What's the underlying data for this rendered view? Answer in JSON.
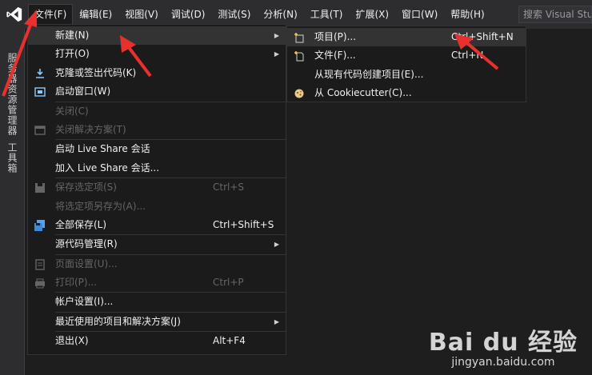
{
  "menubar": {
    "items": [
      "文件(F)",
      "编辑(E)",
      "视图(V)",
      "调试(D)",
      "测试(S)",
      "分析(N)",
      "工具(T)",
      "扩展(X)",
      "窗口(W)",
      "帮助(H)"
    ],
    "search_placeholder": "搜索 Visual Studio"
  },
  "sidebar": {
    "tabs": [
      "服务器资源管理器",
      "工具箱"
    ]
  },
  "file_menu": {
    "items": [
      {
        "label": "新建(N)",
        "has_submenu": true,
        "icon": ""
      },
      {
        "label": "打开(O)",
        "has_submenu": true,
        "icon": ""
      },
      {
        "label": "克隆或签出代码(K)",
        "icon": "download-icon"
      },
      {
        "label": "启动窗口(W)",
        "icon": "start-window-icon"
      },
      {
        "label": "关闭(C)",
        "disabled": true
      },
      {
        "label": "关闭解决方案(T)",
        "disabled": true,
        "icon": "close-solution-icon"
      },
      {
        "label": "启动 Live Share 会话"
      },
      {
        "label": "加入 Live Share 会话..."
      },
      {
        "label": "保存选定项(S)",
        "shortcut": "Ctrl+S",
        "disabled": true,
        "icon": "save-icon"
      },
      {
        "label": "将选定项另存为(A)...",
        "disabled": true
      },
      {
        "label": "全部保存(L)",
        "shortcut": "Ctrl+Shift+S",
        "icon": "save-all-icon"
      },
      {
        "label": "源代码管理(R)",
        "has_submenu": true
      },
      {
        "label": "页面设置(U)...",
        "disabled": true,
        "icon": "page-setup-icon"
      },
      {
        "label": "打印(P)...",
        "shortcut": "Ctrl+P",
        "disabled": true,
        "icon": "print-icon"
      },
      {
        "label": "帐户设置(I)..."
      },
      {
        "label": "最近使用的项目和解决方案(J)",
        "has_submenu": true
      },
      {
        "label": "退出(X)",
        "shortcut": "Alt+F4"
      }
    ]
  },
  "new_submenu": {
    "items": [
      {
        "label": "项目(P)...",
        "shortcut": "Ctrl+Shift+N",
        "icon": "new-project-icon"
      },
      {
        "label": "文件(F)...",
        "shortcut": "Ctrl+N",
        "icon": "new-file-icon"
      },
      {
        "label": "从现有代码创建项目(E)..."
      },
      {
        "label": "从 Cookiecutter(C)...",
        "icon": "cookiecutter-icon"
      }
    ]
  },
  "watermark": {
    "brand": "Bai du 经验",
    "url": "jingyan.baidu.com"
  },
  "colors": {
    "background": "#1e1e1e",
    "menubar": "#2d2d30",
    "menu": "#1b1b1c",
    "highlight": "#333334",
    "vs_purple": "#865fc5",
    "annotation_red": "#e8312f"
  }
}
